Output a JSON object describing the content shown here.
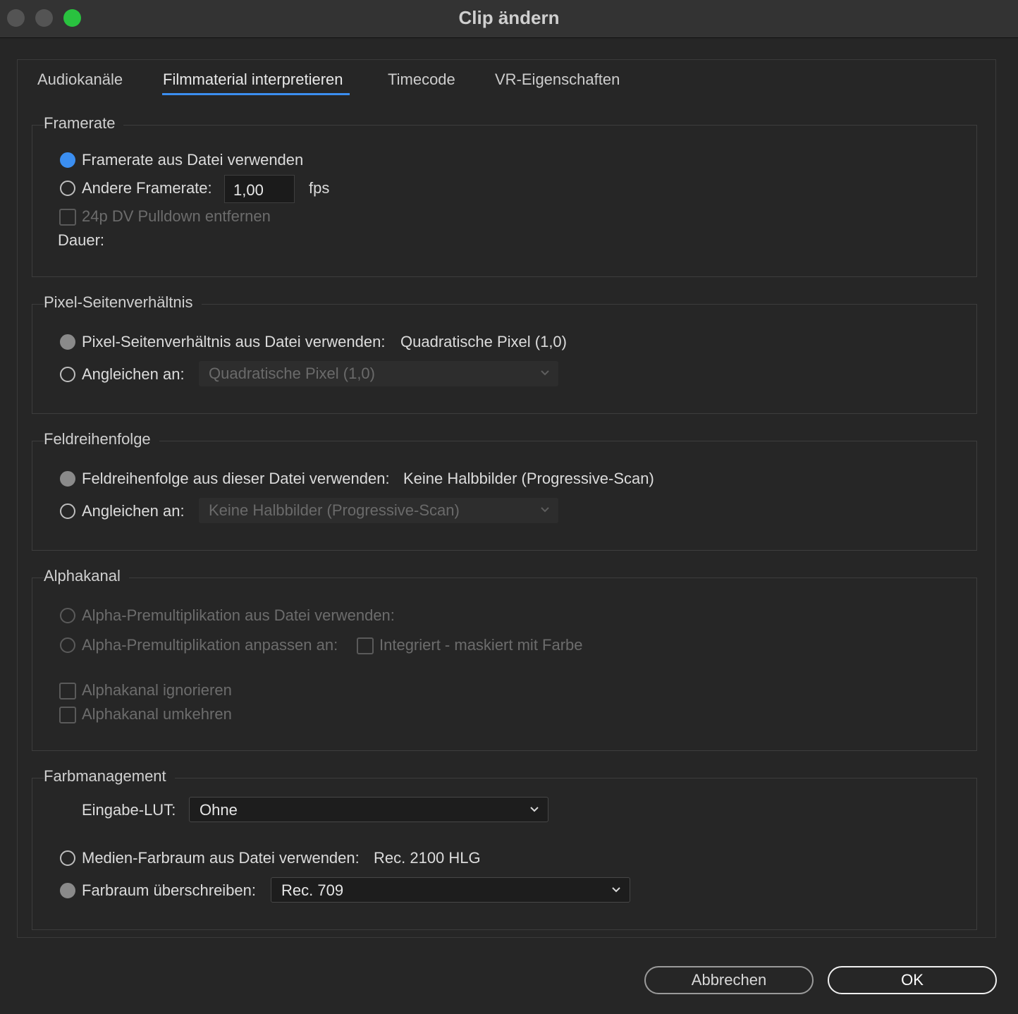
{
  "window": {
    "title": "Clip ändern"
  },
  "tabs": [
    {
      "label": "Audiokanäle"
    },
    {
      "label": "Filmmaterial interpretieren"
    },
    {
      "label": "Timecode"
    },
    {
      "label": "VR-Eigenschaften"
    }
  ],
  "active_tab": "Filmmaterial interpretieren",
  "framerate": {
    "legend": "Framerate",
    "use_file_label": "Framerate aus Datei verwenden",
    "other_label": "Andere Framerate:",
    "other_value": "1,00",
    "fps_unit": "fps",
    "pulldown_label": "24p DV Pulldown entfernen",
    "duration_label": "Dauer:"
  },
  "pixel_aspect": {
    "legend": "Pixel-Seitenverhältnis",
    "use_file_label": "Pixel-Seitenverhältnis aus Datei verwenden:",
    "use_file_value": "Quadratische Pixel (1,0)",
    "conform_label": "Angleichen an:",
    "conform_value": "Quadratische Pixel (1,0)"
  },
  "field_order": {
    "legend": "Feldreihenfolge",
    "use_file_label": "Feldreihenfolge aus dieser Datei verwenden:",
    "use_file_value": "Keine Halbbilder (Progressive-Scan)",
    "conform_label": "Angleichen an:",
    "conform_value": "Keine Halbbilder (Progressive-Scan)"
  },
  "alpha": {
    "legend": "Alphakanal",
    "use_file_label": "Alpha-Premultiplikation aus Datei verwenden:",
    "adjust_label": "Alpha-Premultiplikation anpassen an:",
    "integrated_label": "Integriert - maskiert mit Farbe",
    "ignore_label": "Alphakanal ignorieren",
    "invert_label": "Alphakanal umkehren"
  },
  "color_management": {
    "legend": "Farbmanagement",
    "input_lut_label": "Eingabe-LUT:",
    "input_lut_value": "Ohne",
    "media_colorspace_label": "Medien-Farbraum aus Datei verwenden:",
    "media_colorspace_value": "Rec. 2100 HLG",
    "override_label": "Farbraum überschreiben:",
    "override_value": "Rec. 709"
  },
  "buttons": {
    "cancel": "Abbrechen",
    "ok": "OK"
  },
  "colors": {
    "accent": "#3b8ef0",
    "window_bg": "#262626",
    "green_button": "#29c23f"
  }
}
